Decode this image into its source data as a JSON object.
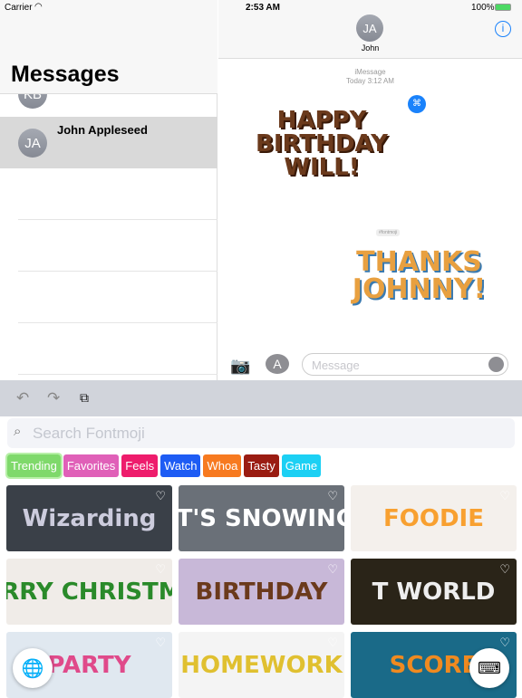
{
  "status": {
    "carrier": "Carrier",
    "time": "2:53 AM",
    "battery": "100%"
  },
  "sidebar": {
    "title": "Messages",
    "partial_avatar": "KB",
    "conversations": [
      {
        "initials": "JA",
        "name": "John Appleseed"
      }
    ]
  },
  "chat": {
    "contact_initials": "JA",
    "contact_name": "John",
    "service": "iMessage",
    "timestamp": "Today 3:12 AM",
    "stickers": [
      {
        "text": "HAPPY BIRTHDAY WILL!"
      },
      {
        "label": "#fontmoji"
      },
      {
        "text": "THANKS JOHNNY!"
      }
    ],
    "input_placeholder": "Message"
  },
  "keyboard": {
    "search_placeholder": "Search Fontmoji",
    "categories": [
      {
        "label": "Trending",
        "color": "#7fd96b"
      },
      {
        "label": "Favorites",
        "color": "#e060b8"
      },
      {
        "label": "Feels",
        "color": "#ee1c6c"
      },
      {
        "label": "Watch",
        "color": "#1e5cf4"
      },
      {
        "label": "Whoa",
        "color": "#f77a20"
      },
      {
        "label": "Tasty",
        "color": "#9a1c12"
      },
      {
        "label": "Game",
        "color": "#1cd0f4"
      }
    ],
    "tiles": [
      "Wizarding",
      "IT'S SNOWING",
      "FOODIE",
      "MERRY CHRISTMAS",
      "BIRTHDAY",
      "T WORLD",
      "PARTY",
      "HOMEWORK",
      "SCORE"
    ]
  },
  "accent": "#1a82fb"
}
